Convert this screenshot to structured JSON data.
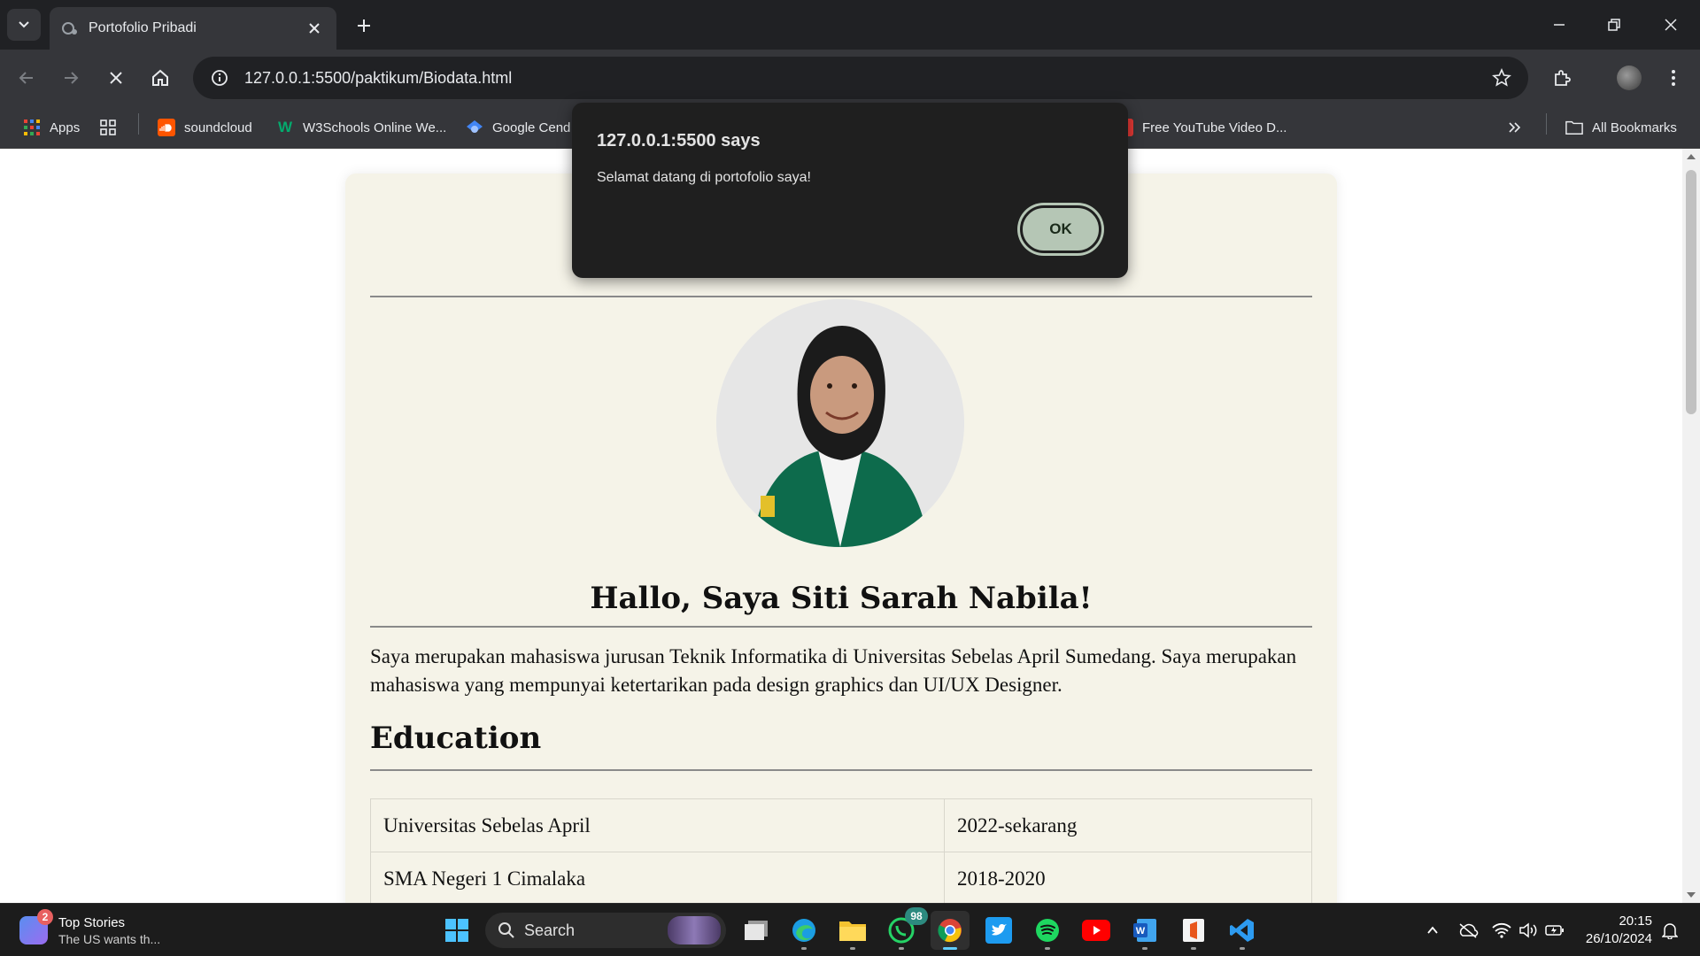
{
  "browser": {
    "tab_title": "Portofolio Pribadi",
    "url": "127.0.0.1:5500/paktikum/Biodata.html",
    "bookmarks": [
      {
        "label": "Apps",
        "icon": "apps-grid-icon"
      },
      {
        "label": "soundcloud",
        "icon": "soundcloud-icon"
      },
      {
        "label": "W3Schools Online We...",
        "icon": "w3schools-icon"
      },
      {
        "label": "Google Cend",
        "icon": "google-cendekia-icon"
      },
      {
        "label": "Free YouTube Video D...",
        "icon": "youtube-downloader-icon"
      },
      {
        "label": "All Bookmarks",
        "icon": "folder-icon"
      }
    ]
  },
  "dialog": {
    "title": "127.0.0.1:5500 says",
    "message": "Selamat datang di portofolio saya!",
    "ok_label": "OK"
  },
  "page": {
    "greeting": "Hallo, Saya Siti Sarah Nabila!",
    "intro": "Saya merupakan mahasiswa jurusan Teknik Informatika di Universitas Sebelas April Sumedang. Saya merupakan mahasiswa yang mempunyai ketertarikan pada design graphics dan UI/UX Designer.",
    "education_title": "Education",
    "education": [
      {
        "school": "Universitas Sebelas April",
        "years": "2022-sekarang"
      },
      {
        "school": "SMA Negeri 1 Cimalaka",
        "years": "2018-2020"
      }
    ]
  },
  "taskbar": {
    "news_title": "Top Stories",
    "news_subtitle": "The US wants th...",
    "news_badge": "2",
    "search_label": "Search",
    "whatsapp_badge": "98",
    "time": "20:15",
    "date": "26/10/2024"
  },
  "colors": {
    "card_background": "#f5f3e8",
    "dialog_background": "#1f1f1f",
    "ok_button": "#b5c6b5",
    "chrome_dark": "#202124"
  }
}
